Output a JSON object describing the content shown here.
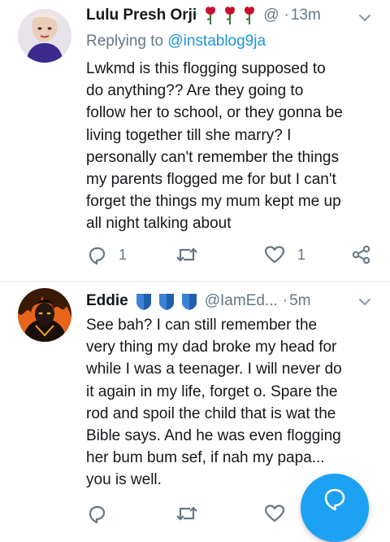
{
  "tweets": [
    {
      "name": "Lulu Presh Orji",
      "badges": [
        "rose-emoji",
        "rose-emoji",
        "rose-emoji"
      ],
      "handle": "@",
      "time": "13m",
      "reply_label": "Replying to",
      "reply_to": "@instablog9ja",
      "text": "Lwkmd is this flogging supposed to\ndo anything?? Are they going to\nfollow her to school, or they gonna be\nliving together till she marry? I\npersonally can't remember the things\nmy parents flogged me for but I can't\nforget the things my mum kept me up\nall night talking about",
      "reply_count": "1",
      "like_count": "1"
    },
    {
      "name": "Eddie",
      "badges": [
        "blue-heart-emoji",
        "blue-heart-emoji",
        "blue-heart-emoji"
      ],
      "handle": "@IamEd...",
      "time": "5m",
      "text": "See bah? I can still remember the\nvery thing my dad broke my head for\nwhile I was a teenager. I will never do\nit again in my life, forget o. Spare the\nrod and spoil the child that is wat the\nBible says. And he was even flogging\nher bum bum sef, if nah my papa...\nyou is well."
    }
  ],
  "separator": "·",
  "colors": {
    "text": "#14171a",
    "secondary": "#657786",
    "link": "#1b95e0",
    "accent": "#1da1f2",
    "rose": "#c8102e",
    "heart_blue": "#3b82d6",
    "divider": "#e1e8ed"
  }
}
